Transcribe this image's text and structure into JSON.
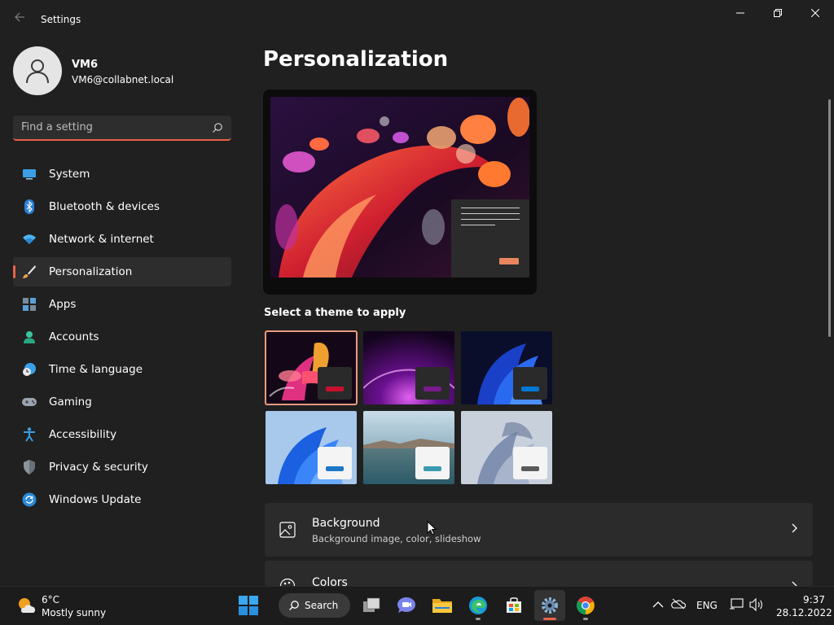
{
  "window": {
    "title": "Settings",
    "back_icon": "back-arrow-icon",
    "controls": [
      "minimize-icon",
      "restore-icon",
      "close-icon"
    ]
  },
  "profile": {
    "name": "VM6",
    "email": "VM6@collabnet.local"
  },
  "search": {
    "placeholder": "Find a setting"
  },
  "nav": {
    "items": [
      {
        "label": "System",
        "icon": "monitor-icon"
      },
      {
        "label": "Bluetooth & devices",
        "icon": "bluetooth-icon"
      },
      {
        "label": "Network & internet",
        "icon": "wifi-icon"
      },
      {
        "label": "Personalization",
        "icon": "brush-icon",
        "selected": true
      },
      {
        "label": "Apps",
        "icon": "apps-icon"
      },
      {
        "label": "Accounts",
        "icon": "person-icon"
      },
      {
        "label": "Time & language",
        "icon": "clock-globe-icon"
      },
      {
        "label": "Gaming",
        "icon": "gamepad-icon"
      },
      {
        "label": "Accessibility",
        "icon": "accessibility-icon"
      },
      {
        "label": "Privacy & security",
        "icon": "shield-icon"
      },
      {
        "label": "Windows Update",
        "icon": "update-icon"
      }
    ]
  },
  "main": {
    "title": "Personalization",
    "theme_heading": "Select a theme to apply",
    "themes": [
      {
        "name": "glow",
        "selected": true,
        "accent": "#c8102e"
      },
      {
        "name": "sunrise-purple",
        "accent": "#7a1a8c"
      },
      {
        "name": "windows-dark",
        "accent": "#0078d4"
      },
      {
        "name": "windows-light",
        "accent": "#1e76c8"
      },
      {
        "name": "captured-motion",
        "accent": "#3a9bb0"
      },
      {
        "name": "flow",
        "accent": "#5a5a5a"
      }
    ],
    "cards": [
      {
        "title": "Background",
        "subtitle": "Background image, color, slideshow",
        "icon": "image-icon"
      },
      {
        "title": "Colors",
        "subtitle": "",
        "icon": "palette-icon"
      }
    ]
  },
  "taskbar": {
    "weather": {
      "temp": "6°C",
      "desc": "Mostly sunny",
      "icon": "sun-cloud-icon"
    },
    "search_label": "Search",
    "apps": [
      "start-icon",
      "task-view-icon",
      "teams-chat-icon",
      "file-explorer-icon",
      "edge-icon",
      "store-icon",
      "settings-gear-icon",
      "chrome-icon"
    ],
    "tray": {
      "language": "ENG",
      "time": "9:37",
      "date": "28.12.2022"
    }
  },
  "colors": {
    "accent": "#e8634a",
    "background": "#202020",
    "card": "#2b2b2b"
  }
}
